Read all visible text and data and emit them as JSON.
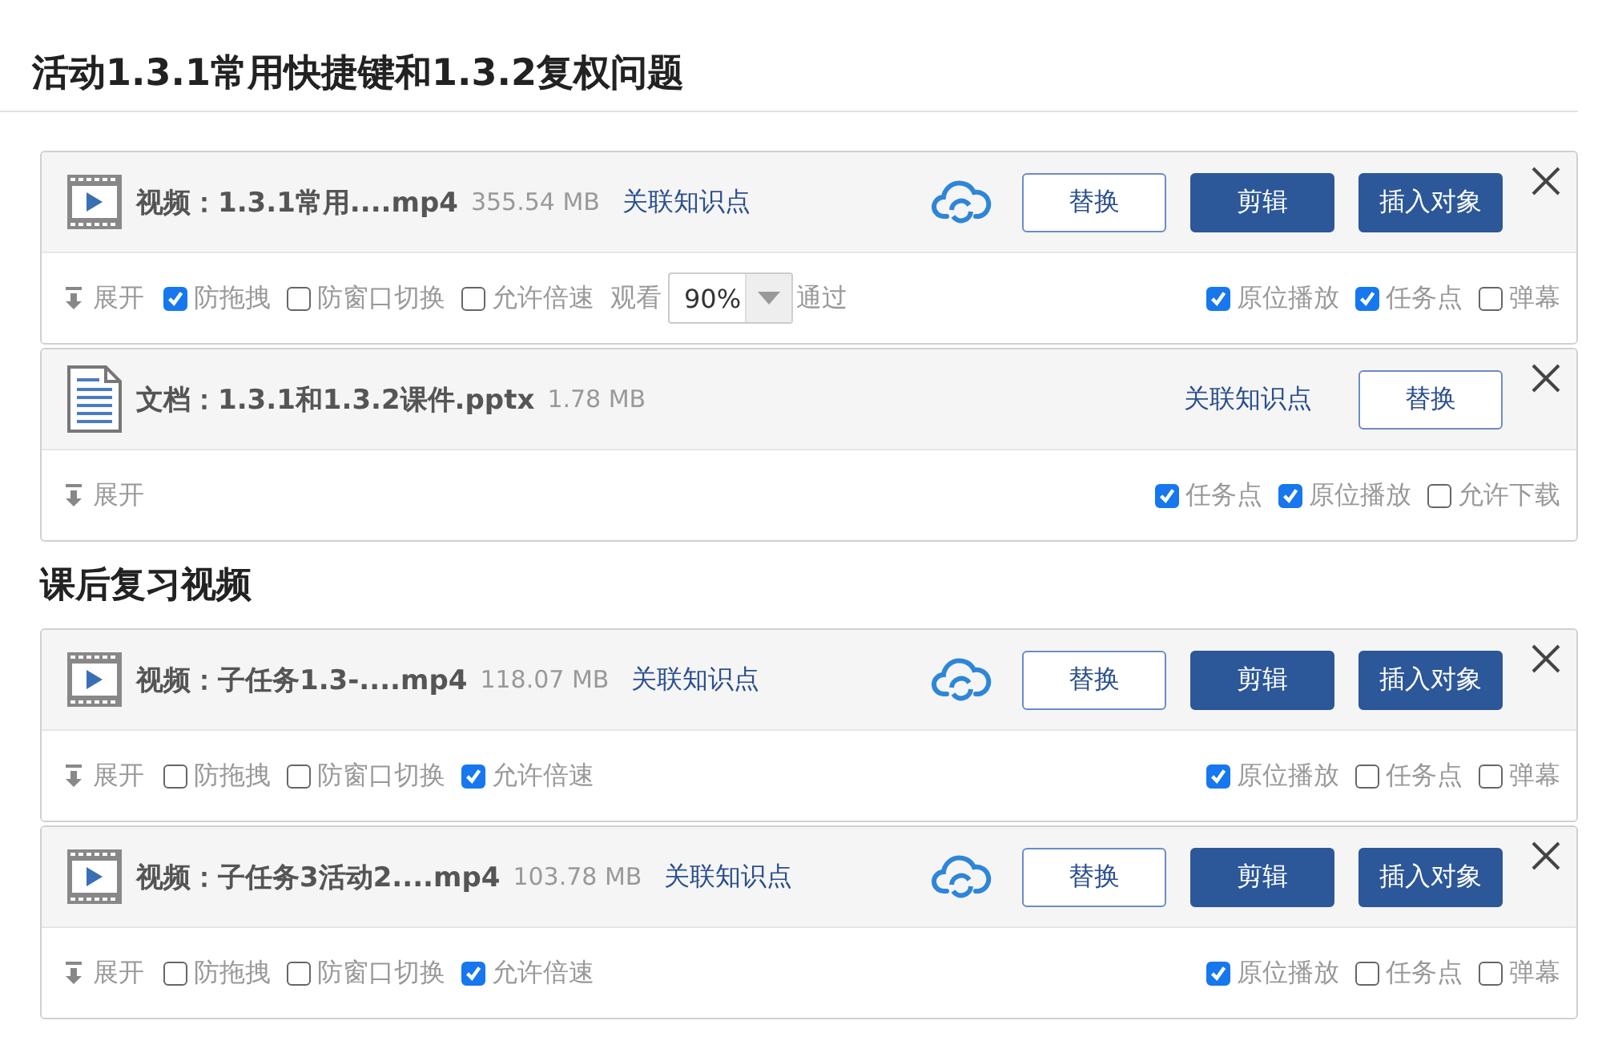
{
  "title": "活动1.3.1常用快捷键和1.3.2复权问题",
  "sections": [
    {
      "items": [
        {
          "kind": "video",
          "name": "视频：1.3.1常用....mp4",
          "size": "355.54 MB",
          "link": "关联知识点",
          "buttons": [
            {
              "label": "替换",
              "kind": "outline"
            },
            {
              "label": "剪辑",
              "kind": "primary"
            },
            {
              "label": "插入对象",
              "kind": "primary"
            }
          ],
          "expand": "展开",
          "left_options": [
            {
              "kind": "checkbox",
              "label": "防拖拽",
              "checked": true
            },
            {
              "kind": "checkbox",
              "label": "防窗口切换",
              "checked": false
            },
            {
              "kind": "checkbox",
              "label": "允许倍速",
              "checked": false
            },
            {
              "kind": "watch",
              "label": "观看",
              "value": "90%",
              "suffix": "通过"
            }
          ],
          "right_options": [
            {
              "label": "原位播放",
              "checked": true
            },
            {
              "label": "任务点",
              "checked": true
            },
            {
              "label": "弹幕",
              "checked": false
            }
          ]
        },
        {
          "kind": "document",
          "name": "文档：1.3.1和1.3.2课件.pptx",
          "size": "1.78 MB",
          "link": "关联知识点",
          "buttons": [
            {
              "label": "替换",
              "kind": "outline"
            }
          ],
          "expand": "展开",
          "right_options": [
            {
              "label": "任务点",
              "checked": true
            },
            {
              "label": "原位播放",
              "checked": true
            },
            {
              "label": "允许下载",
              "checked": false
            }
          ]
        }
      ]
    },
    {
      "heading": "课后复习视频",
      "items": [
        {
          "kind": "video",
          "name": "视频：子任务1.3-....mp4",
          "size": "118.07 MB",
          "link": "关联知识点",
          "buttons": [
            {
              "label": "替换",
              "kind": "outline"
            },
            {
              "label": "剪辑",
              "kind": "primary"
            },
            {
              "label": "插入对象",
              "kind": "primary"
            }
          ],
          "expand": "展开",
          "left_options": [
            {
              "kind": "checkbox",
              "label": "防拖拽",
              "checked": false
            },
            {
              "kind": "checkbox",
              "label": "防窗口切换",
              "checked": false
            },
            {
              "kind": "checkbox",
              "label": "允许倍速",
              "checked": true
            }
          ],
          "right_options": [
            {
              "label": "原位播放",
              "checked": true
            },
            {
              "label": "任务点",
              "checked": false
            },
            {
              "label": "弹幕",
              "checked": false
            }
          ]
        },
        {
          "kind": "video",
          "name": "视频：子任务3活动2....mp4",
          "size": "103.78 MB",
          "link": "关联知识点",
          "buttons": [
            {
              "label": "替换",
              "kind": "outline"
            },
            {
              "label": "剪辑",
              "kind": "primary"
            },
            {
              "label": "插入对象",
              "kind": "primary"
            }
          ],
          "expand": "展开",
          "left_options": [
            {
              "kind": "checkbox",
              "label": "防拖拽",
              "checked": false
            },
            {
              "kind": "checkbox",
              "label": "防窗口切换",
              "checked": false
            },
            {
              "kind": "checkbox",
              "label": "允许倍速",
              "checked": true
            }
          ],
          "right_options": [
            {
              "label": "原位播放",
              "checked": true
            },
            {
              "label": "任务点",
              "checked": false
            },
            {
              "label": "弹幕",
              "checked": false
            }
          ]
        }
      ]
    }
  ]
}
